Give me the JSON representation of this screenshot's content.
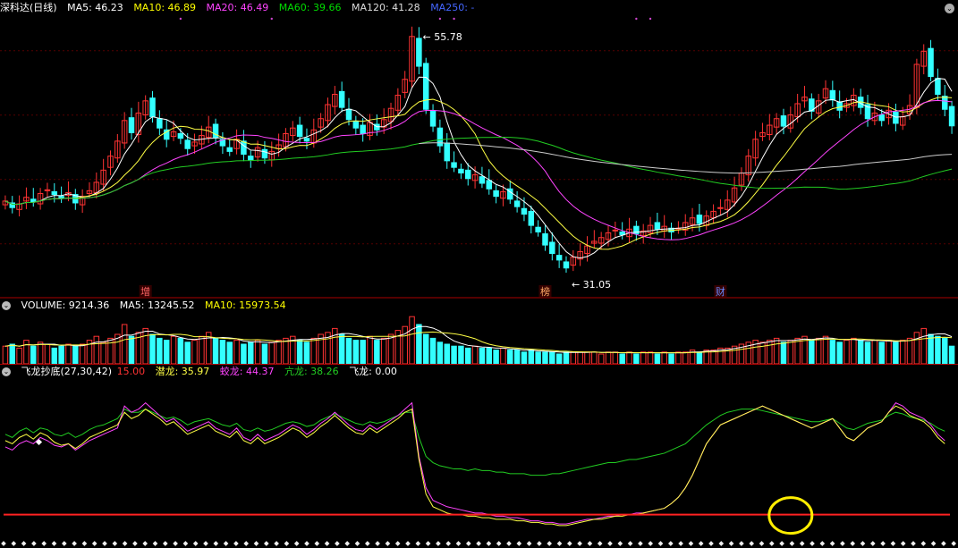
{
  "main_panel": {
    "title": "深科达(日线)",
    "ma": [
      {
        "label": "MA5: 46.23",
        "color": "#ffffff"
      },
      {
        "label": "MA10: 46.89",
        "color": "#ffff00"
      },
      {
        "label": "MA20: 46.49",
        "color": "#ff44ff"
      },
      {
        "label": "MA60: 39.66",
        "color": "#00dd00"
      },
      {
        "label": "MA120: 41.28",
        "color": "#dddddd"
      },
      {
        "label": "MA250: -",
        "color": "#4466ff"
      }
    ],
    "high_label": "55.78",
    "low_label": "31.05",
    "markers": [
      "增",
      "榜",
      "财"
    ],
    "dates_hint": "daily candlesticks"
  },
  "volume_panel": {
    "title": "VOLUME: 9214.36",
    "ma5": "MA5: 13245.52",
    "ma10": "MA10: 15973.54"
  },
  "indicator_panel": {
    "title": "飞龙抄底(27,30,42)",
    "threshold": "15.00",
    "qianlong": "潜龙: 35.97",
    "jiaolong": "蛟龙: 44.37",
    "kanglong": "亢龙: 38.26",
    "feilong": "飞龙: 0.00"
  },
  "colors": {
    "up": "#ff3333",
    "down": "#33ffff",
    "ma5": "#ffffff",
    "ma10": "#ffff44",
    "ma20": "#ff44ff",
    "ma60": "#22cc22",
    "ma120": "#cccccc",
    "highlight": "#ffee00",
    "axis_red": "#aa0000"
  },
  "chart_data": {
    "type": "line",
    "close": [
      38.2,
      37.5,
      37.9,
      38.6,
      38.1,
      39.0,
      39.4,
      38.9,
      38.5,
      39.1,
      38.0,
      38.7,
      39.3,
      40.2,
      41.5,
      43.0,
      44.6,
      46.8,
      45.5,
      47.6,
      48.9,
      47.2,
      46.0,
      44.8,
      45.6,
      44.9,
      43.8,
      44.5,
      45.2,
      46.1,
      45.0,
      44.1,
      43.5,
      44.8,
      43.2,
      42.6,
      43.9,
      42.8,
      43.5,
      44.2,
      45.4,
      46.0,
      45.1,
      44.6,
      45.8,
      47.0,
      48.5,
      49.6,
      48.2,
      46.9,
      46.0,
      45.4,
      46.6,
      45.8,
      46.9,
      48.1,
      49.5,
      51.2,
      55.78,
      52.6,
      48.0,
      46.2,
      44.1,
      42.5,
      41.8,
      41.2,
      40.6,
      41.0,
      40.1,
      39.5,
      38.7,
      39.2,
      38.4,
      37.6,
      36.8,
      35.6,
      34.9,
      33.5,
      32.6,
      31.9,
      31.05,
      32.2,
      32.8,
      33.4,
      33.9,
      34.3,
      34.8,
      35.1,
      34.6,
      35.2,
      34.7,
      35.0,
      35.6,
      35.2,
      35.5,
      34.9,
      35.3,
      35.9,
      36.4,
      35.8,
      36.6,
      37.1,
      37.5,
      38.3,
      39.6,
      41.2,
      43.0,
      44.8,
      45.5,
      46.3,
      47.0,
      46.2,
      47.4,
      48.6,
      49.3,
      47.8,
      48.9,
      50.2,
      49.0,
      47.9,
      48.6,
      49.5,
      48.2,
      47.0,
      47.6,
      46.8,
      47.9,
      46.5,
      47.2,
      48.4,
      52.8,
      54.2,
      51.5,
      49.6,
      48.0,
      46.23
    ],
    "volume": [
      9,
      10,
      8,
      12,
      9,
      11,
      10,
      8,
      9,
      10,
      9,
      10,
      12,
      14,
      11,
      13,
      15,
      20,
      14,
      16,
      18,
      15,
      13,
      12,
      14,
      13,
      11,
      12,
      14,
      16,
      13,
      12,
      11,
      12,
      10,
      11,
      12,
      10,
      11,
      12,
      13,
      14,
      12,
      11,
      13,
      15,
      16,
      18,
      15,
      13,
      12,
      12,
      14,
      12,
      13,
      15,
      17,
      19,
      24,
      20,
      15,
      13,
      11,
      10,
      9,
      9,
      8,
      9,
      8,
      8,
      7,
      8,
      7,
      7,
      6,
      7,
      6,
      6,
      6,
      5,
      6,
      6,
      6,
      6,
      6,
      5,
      6,
      6,
      5,
      6,
      5,
      6,
      6,
      5,
      6,
      5,
      6,
      6,
      7,
      6,
      7,
      7,
      8,
      8,
      9,
      10,
      11,
      12,
      11,
      12,
      13,
      11,
      12,
      13,
      14,
      12,
      13,
      14,
      12,
      11,
      12,
      13,
      12,
      11,
      12,
      11,
      12,
      11,
      12,
      13,
      16,
      18,
      15,
      14,
      13,
      9
    ],
    "qianlong": [
      62,
      60,
      64,
      66,
      63,
      67,
      65,
      61,
      59,
      60,
      57,
      60,
      64,
      66,
      68,
      70,
      72,
      80,
      76,
      78,
      82,
      79,
      76,
      72,
      74,
      70,
      66,
      68,
      70,
      72,
      68,
      66,
      64,
      68,
      62,
      60,
      64,
      60,
      62,
      64,
      67,
      70,
      68,
      64,
      67,
      71,
      74,
      78,
      74,
      70,
      67,
      66,
      70,
      67,
      70,
      73,
      76,
      80,
      82,
      50,
      28,
      20,
      18,
      16,
      15,
      15,
      14,
      14,
      13,
      13,
      12,
      12,
      12,
      11,
      11,
      10,
      10,
      9,
      9,
      8,
      8,
      9,
      10,
      11,
      12,
      12,
      13,
      14,
      14,
      15,
      15,
      16,
      17,
      18,
      19,
      22,
      26,
      32,
      40,
      50,
      60,
      66,
      72,
      74,
      76,
      78,
      80,
      82,
      84,
      82,
      80,
      78,
      76,
      74,
      72,
      70,
      72,
      74,
      76,
      70,
      64,
      62,
      66,
      70,
      72,
      74,
      80,
      84,
      82,
      78,
      76,
      74,
      70,
      64,
      60
    ],
    "jiaolong": [
      58,
      56,
      60,
      62,
      60,
      64,
      62,
      59,
      58,
      60,
      56,
      59,
      62,
      64,
      66,
      68,
      70,
      84,
      80,
      82,
      86,
      82,
      78,
      74,
      76,
      72,
      68,
      70,
      72,
      74,
      70,
      68,
      66,
      70,
      64,
      62,
      66,
      62,
      64,
      66,
      69,
      72,
      70,
      66,
      69,
      73,
      76,
      80,
      76,
      72,
      69,
      68,
      72,
      69,
      72,
      75,
      78,
      82,
      86,
      52,
      32,
      24,
      22,
      20,
      19,
      18,
      17,
      16,
      16,
      15,
      14,
      14,
      13,
      13,
      12,
      11,
      11,
      10,
      10,
      9,
      9,
      10,
      11,
      12,
      12,
      13,
      14,
      14,
      15,
      15,
      16,
      16,
      17,
      18,
      19,
      22,
      26,
      32,
      40,
      50,
      60,
      66,
      72,
      74,
      76,
      78,
      80,
      82,
      84,
      82,
      80,
      78,
      76,
      74,
      72,
      70,
      72,
      74,
      76,
      70,
      64,
      62,
      66,
      70,
      72,
      74,
      80,
      86,
      84,
      80,
      78,
      76,
      72,
      66,
      62
    ],
    "kanglong": [
      66,
      64,
      68,
      70,
      67,
      70,
      69,
      66,
      65,
      67,
      64,
      66,
      69,
      71,
      72,
      74,
      76,
      82,
      80,
      80,
      82,
      80,
      78,
      76,
      77,
      75,
      72,
      74,
      75,
      76,
      74,
      72,
      71,
      73,
      69,
      68,
      70,
      68,
      69,
      71,
      73,
      74,
      73,
      71,
      72,
      75,
      77,
      79,
      77,
      75,
      73,
      72,
      74,
      73,
      74,
      76,
      78,
      80,
      80,
      64,
      52,
      48,
      46,
      45,
      44,
      44,
      43,
      44,
      43,
      43,
      42,
      42,
      41,
      41,
      41,
      40,
      40,
      40,
      41,
      41,
      42,
      43,
      44,
      45,
      46,
      47,
      48,
      48,
      49,
      50,
      50,
      51,
      52,
      53,
      54,
      56,
      58,
      60,
      64,
      68,
      72,
      75,
      78,
      80,
      81,
      82,
      82,
      82,
      81,
      80,
      79,
      78,
      77,
      76,
      75,
      74,
      74,
      75,
      76,
      73,
      70,
      69,
      71,
      73,
      74,
      75,
      78,
      80,
      79,
      77,
      76,
      75,
      73,
      70,
      68
    ]
  }
}
